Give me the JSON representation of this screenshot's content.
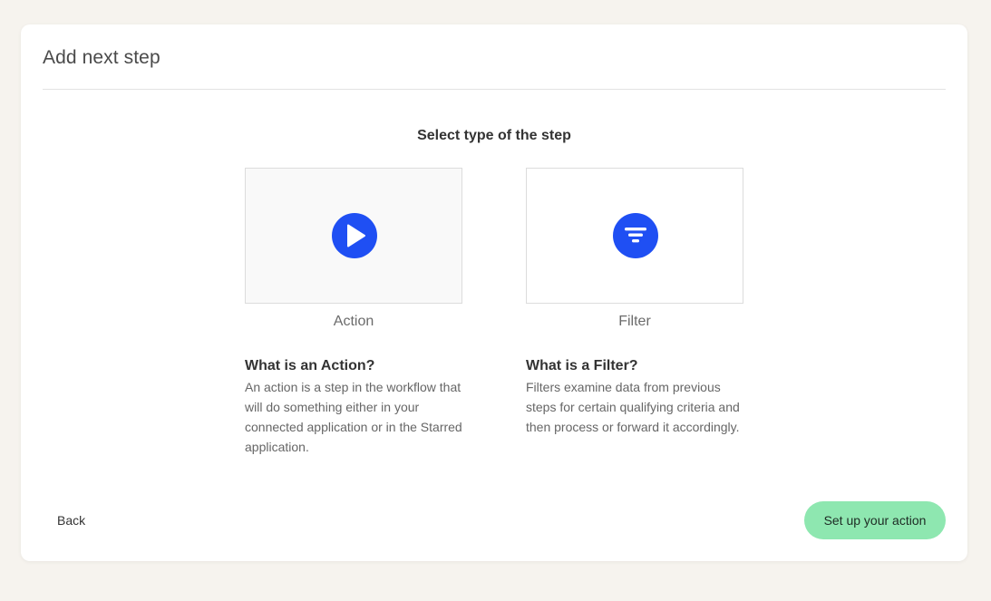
{
  "modal": {
    "title": "Add next step",
    "heading": "Select type of the step"
  },
  "options": [
    {
      "label": "Action",
      "icon": "play-icon",
      "selected": true,
      "info_title": "What is an Action?",
      "info_body": "An action is a step in the workflow that will do something either in your connected application or in the Starred application."
    },
    {
      "label": "Filter",
      "icon": "filter-icon",
      "selected": false,
      "info_title": "What is a Filter?",
      "info_body": "Filters examine data from previous steps for certain qualifying criteria and then process or forward it accordingly."
    }
  ],
  "footer": {
    "back_label": "Back",
    "primary_label": "Set up your action"
  },
  "colors": {
    "icon_blue": "#1f4ff3",
    "primary_button": "#8ee7b0",
    "page_background": "#f6f3ee",
    "selected_card_background": "#f9f9f9"
  }
}
